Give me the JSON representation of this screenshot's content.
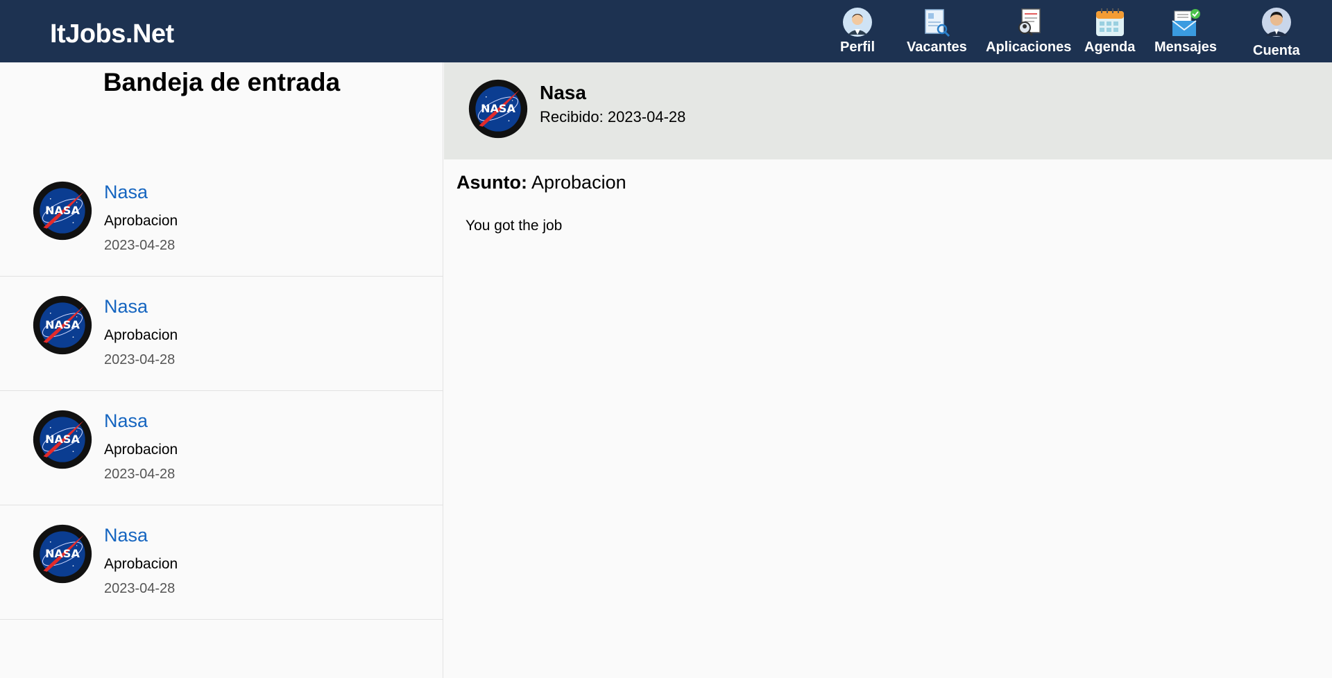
{
  "app": {
    "brand": "ItJobs.Net"
  },
  "nav": {
    "perfil": "Perfil",
    "vacantes": "Vacantes",
    "aplicaciones": "Aplicaciones",
    "agenda": "Agenda",
    "mensajes": "Mensajes",
    "cuenta": "Cuenta"
  },
  "inbox": {
    "title": "Bandeja de entrada",
    "messages": [
      {
        "sender": "Nasa",
        "subject": "Aprobacion",
        "date": "2023-04-28",
        "avatar_text": "NASA"
      },
      {
        "sender": "Nasa",
        "subject": "Aprobacion",
        "date": "2023-04-28",
        "avatar_text": "NASA"
      },
      {
        "sender": "Nasa",
        "subject": "Aprobacion",
        "date": "2023-04-28",
        "avatar_text": "NASA"
      },
      {
        "sender": "Nasa",
        "subject": "Aprobacion",
        "date": "2023-04-28",
        "avatar_text": "NASA"
      }
    ]
  },
  "detail": {
    "sender": "Nasa",
    "received_label": "Recibido:",
    "received_date": "2023-04-28",
    "received_text": "Recibido: 2023-04-28",
    "subject_label": "Asunto:",
    "subject": "Aprobacion",
    "body": "You got the job"
  },
  "colors": {
    "topbar": "#1d3251",
    "sender_link": "#1565c0",
    "detail_header": "#e5e7e4"
  }
}
